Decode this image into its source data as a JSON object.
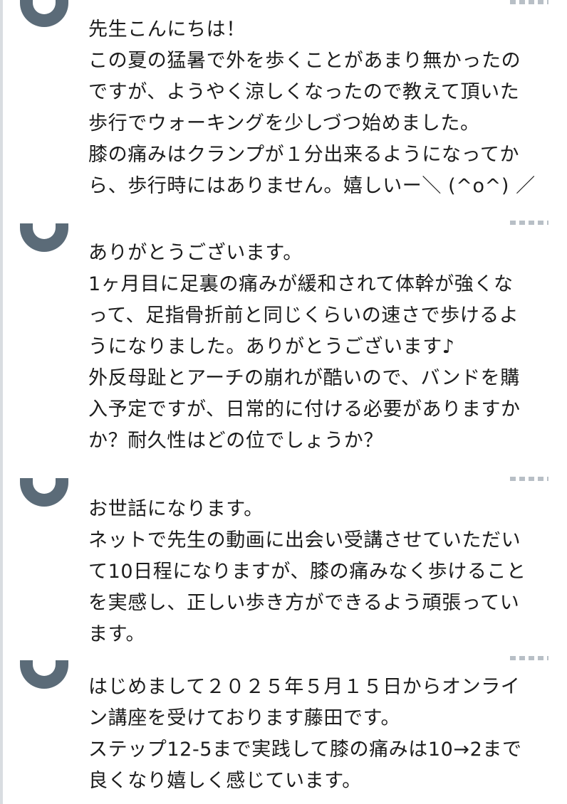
{
  "comments": [
    {
      "lines": [
        "先生こんにちは！",
        "この夏の猛暑で外を歩くことがあまり無かったの",
        "ですが、ようやく涼しくなったので教えて頂いた",
        "歩行でウォーキングを少しづつ始めました。",
        "膝の痛みはクランプが１分出来るようになってか",
        "ら、歩行時にはありません。嬉しいー＼ (^o^) ／"
      ]
    },
    {
      "lines": [
        "ありがとうございます。",
        "1ヶ月目に足裏の痛みが緩和されて体幹が強くな",
        "って、足指骨折前と同じくらいの速さで歩けるよ",
        "うになりました。ありがとうございます♪",
        "外反母趾とアーチの崩れが酷いので、バンドを購",
        "入予定ですが、日常的に付ける必要がありますか",
        "か？耐久性はどの位でしょうか？"
      ]
    },
    {
      "lines": [
        "お世話になります。",
        "ネットで先生の動画に出会い受講させていただい",
        "て10日程になりますが、膝の痛みなく歩けること",
        "を実感し、正しい歩き方ができるよう頑張ってい",
        "ます。"
      ]
    },
    {
      "lines": [
        "はじめまして２０２５年５月１５日からオンライ",
        "ン講座を受けております藤田です。",
        "ステップ12-5まで実践して膝の痛みは10→2まで",
        "良くなり嬉しく感じています。"
      ]
    }
  ]
}
